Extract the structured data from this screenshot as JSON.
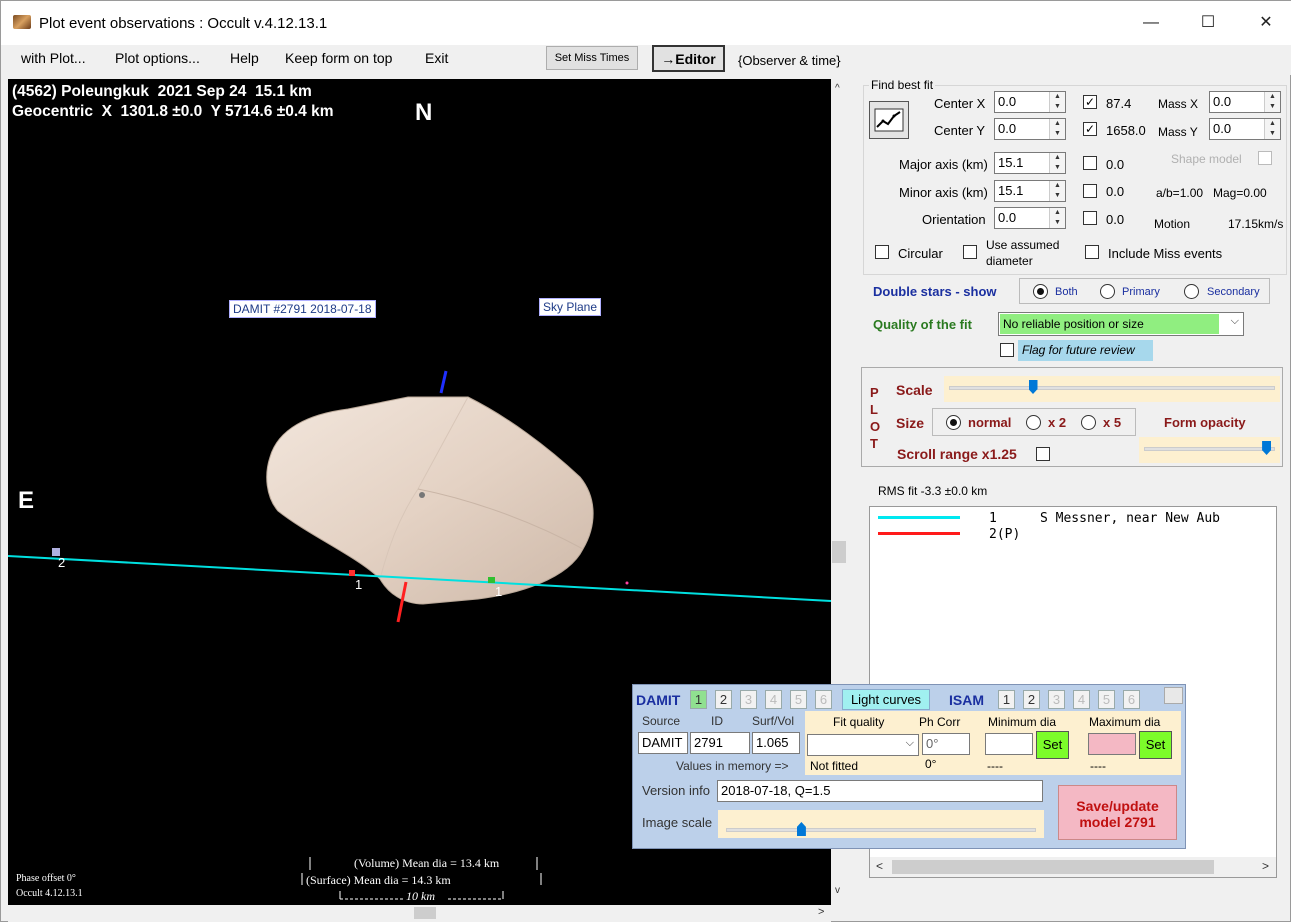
{
  "window": {
    "title": "Plot event observations : Occult v.4.12.13.1",
    "minimize": "—",
    "maximize": "☐",
    "close": "✕"
  },
  "menu": {
    "items": [
      "with Plot...",
      "Plot options...",
      "Help",
      "Keep form on top",
      "Exit"
    ],
    "set_miss_times": "Set Miss Times",
    "editor": "→Editor",
    "observer_time": "{Observer & time}"
  },
  "plot": {
    "header_line1": "(4562) Poleungkuk  2021 Sep 24  15.1 km",
    "header_line2": "Geocentric  X  1301.8 ±0.0  Y 5714.6 ±0.4 km",
    "north": "N",
    "east": "E",
    "damit_label": "DAMIT #2791 2018-07-18",
    "sky_plane_label": "Sky Plane",
    "chord_label_2": "2",
    "chord_label_1a": "1",
    "chord_label_1b": "1",
    "phase_offset": "Phase offset 0°",
    "occult_version": "Occult 4.12.13.1",
    "volume_dia": "(Volume) Mean dia = 13.4 km",
    "surface_dia": "(Surface) Mean dia = 14.3 km",
    "scale_bar": "10 km",
    "colors": {
      "chord": "#00e0e0",
      "shape": "#e8d8cc",
      "north_axis": "#1f2fff",
      "south_axis": "#ff2020"
    }
  },
  "fit": {
    "title": "Find best fit",
    "center_x_label": "Center X",
    "center_x": "0.0",
    "center_y_label": "Center Y",
    "center_y": "0.0",
    "major_label": "Major axis (km)",
    "major": "15.1",
    "minor_label": "Minor axis (km)",
    "minor": "15.1",
    "orientation_label": "Orientation",
    "orientation": "0.0",
    "chk_87": "87.4",
    "chk_1658": "1658.0",
    "chk_major": "0.0",
    "chk_minor": "0.0",
    "chk_orient": "0.0",
    "mass_x_label": "Mass X",
    "mass_x": "0.0",
    "mass_y_label": "Mass Y",
    "mass_y": "0.0",
    "shape_model": "Shape model",
    "ab": "a/b=1.00",
    "mag": "Mag=0.00",
    "motion_label": "Motion",
    "motion": "17.15km/s",
    "circular": "Circular",
    "use_assumed": "Use assumed",
    "diameter": "diameter",
    "include_miss": "Include Miss events",
    "double_stars": "Double stars - show",
    "both": "Both",
    "primary": "Primary",
    "secondary": "Secondary",
    "quality_label": "Quality of the fit",
    "quality_value": "No reliable position or size",
    "flag_review": "Flag for future review"
  },
  "plotpanel": {
    "letters": [
      "P",
      "L",
      "O",
      "T"
    ],
    "scale": "Scale",
    "size": "Size",
    "normal": "normal",
    "x2": "x 2",
    "x5": "x 5",
    "form_opacity": "Form opacity",
    "scroll_range": "Scroll range x1.25",
    "scale_slider": 0.25,
    "opacity_slider": 0.96
  },
  "rms": {
    "label": "RMS fit -3.3 ±0.0 km",
    "rows": [
      {
        "num": "1",
        "text": "S Messner, near New Aub",
        "color": "#00e8f0"
      },
      {
        "num": "2(P)",
        "text": "",
        "color": "#ff1a1a"
      }
    ]
  },
  "damit": {
    "damit_label": "DAMIT",
    "damit_tabs": [
      "1",
      "2",
      "3",
      "4",
      "5",
      "6"
    ],
    "light_curves": "Light curves",
    "isam_label": "ISAM",
    "isam_tabs": [
      "1",
      "2",
      "3",
      "4",
      "5",
      "6"
    ],
    "source_label": "Source",
    "id_label": "ID",
    "surf_vol_label": "Surf/Vol",
    "source": "DAMIT",
    "id": "2791",
    "surf_vol": "1.065",
    "fit_quality_label": "Fit quality",
    "ph_corr_label": "Ph Corr",
    "ph_corr": "0°",
    "min_dia_label": "Minimum dia",
    "max_dia_label": "Maximum dia",
    "set": "Set",
    "values_in_memory": "Values in memory =>",
    "not_fitted": "Not fitted",
    "ph_mem": "0°",
    "min_mem": "----",
    "max_mem": "----",
    "version_label": "Version info",
    "version": "2018-07-18, Q=1.5",
    "image_scale_label": "Image scale",
    "image_scale": 0.24,
    "save_update": "Save/update",
    "model": "model 2791"
  }
}
